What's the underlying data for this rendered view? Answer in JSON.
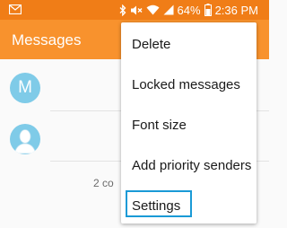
{
  "status_bar": {
    "battery_percent": "64%",
    "time": "2:36 PM",
    "icons": [
      "mail-icon",
      "bluetooth-icon",
      "mute-icon",
      "wifi-icon",
      "signal-icon",
      "battery-icon"
    ]
  },
  "app_bar": {
    "title": "Messages"
  },
  "conversations": [
    {
      "avatar_initial": "M"
    },
    {
      "avatar_icon": "person-icon"
    }
  ],
  "footer": {
    "text": "2 co"
  },
  "menu": {
    "items": [
      {
        "label": "Delete"
      },
      {
        "label": "Locked messages"
      },
      {
        "label": "Font size"
      },
      {
        "label": "Add priority senders"
      },
      {
        "label": "Settings"
      }
    ],
    "highlighted": "Settings"
  },
  "colors": {
    "status_bar": "#f07d17",
    "app_bar": "#f8922d",
    "avatar": "#7fcbe8",
    "highlight": "#1a9ad6"
  }
}
